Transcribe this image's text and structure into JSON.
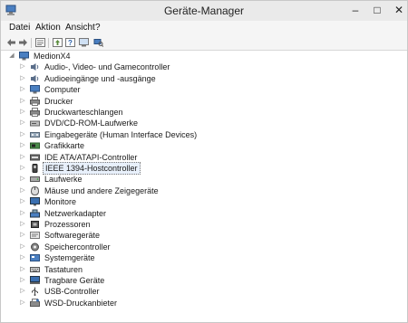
{
  "window": {
    "title": "Geräte-Manager"
  },
  "menu": {
    "items": [
      "Datei",
      "Aktion",
      "Ansicht",
      "?"
    ]
  },
  "tree": {
    "root": {
      "label": "MedionX4"
    },
    "items": [
      {
        "label": "Audio-, Video- und Gamecontroller",
        "icon": "speaker-icon"
      },
      {
        "label": "Audioeingänge und -ausgänge",
        "icon": "speaker-icon"
      },
      {
        "label": "Computer",
        "icon": "computer-icon"
      },
      {
        "label": "Drucker",
        "icon": "printer-icon"
      },
      {
        "label": "Druckwarteschlangen",
        "icon": "printer-icon"
      },
      {
        "label": "DVD/CD-ROM-Laufwerke",
        "icon": "disc-drive-icon"
      },
      {
        "label": "Eingabegeräte (Human Interface Devices)",
        "icon": "hid-icon"
      },
      {
        "label": "Grafikkarte",
        "icon": "display-adapter-icon"
      },
      {
        "label": "IDE ATA/ATAPI-Controller",
        "icon": "ide-controller-icon"
      },
      {
        "label": "IEEE 1394-Hostcontroller",
        "icon": "ieee1394-icon",
        "selected": true
      },
      {
        "label": "Laufwerke",
        "icon": "disk-drive-icon"
      },
      {
        "label": "Mäuse und andere Zeigegeräte",
        "icon": "mouse-icon"
      },
      {
        "label": "Monitore",
        "icon": "monitor-icon"
      },
      {
        "label": "Netzwerkadapter",
        "icon": "network-adapter-icon"
      },
      {
        "label": "Prozessoren",
        "icon": "processor-icon"
      },
      {
        "label": "Softwaregeräte",
        "icon": "software-device-icon"
      },
      {
        "label": "Speichercontroller",
        "icon": "storage-controller-icon"
      },
      {
        "label": "Systemgeräte",
        "icon": "system-device-icon"
      },
      {
        "label": "Tastaturen",
        "icon": "keyboard-icon"
      },
      {
        "label": "Tragbare Geräte",
        "icon": "portable-device-icon"
      },
      {
        "label": "USB-Controller",
        "icon": "usb-icon"
      },
      {
        "label": "WSD-Druckanbieter",
        "icon": "wsd-printer-icon"
      }
    ]
  }
}
